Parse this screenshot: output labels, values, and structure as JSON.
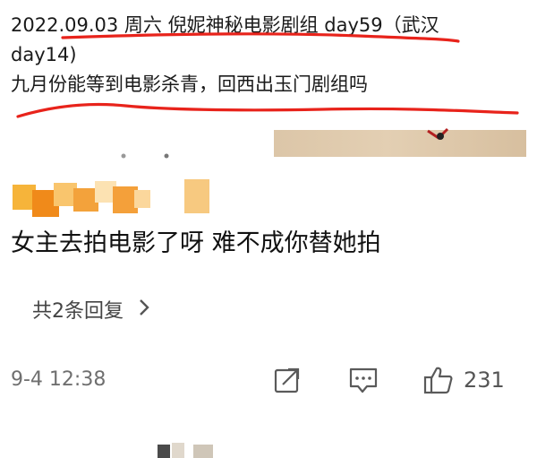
{
  "quoted_post": {
    "line1": "2022.09.03 周六 倪妮神秘电影剧组 day59（武汉",
    "line2": "day14)",
    "line3": "九月份能等到电影杀青，回西出玉门剧组吗"
  },
  "comment": {
    "text": "女主去拍电影了呀  难不成你替她拍"
  },
  "replies": {
    "label": "共2条回复"
  },
  "footer": {
    "timestamp": "9-4 12:38",
    "like_count": "231"
  },
  "colors": {
    "underline": "#e8231b",
    "text": "#111111",
    "muted": "#6f6f6f",
    "icon": "#5a5a5a"
  },
  "icons": {
    "share": "share-icon",
    "comment": "comment-icon",
    "like": "thumbs-up-icon",
    "chevron": "chevron-right-icon"
  }
}
